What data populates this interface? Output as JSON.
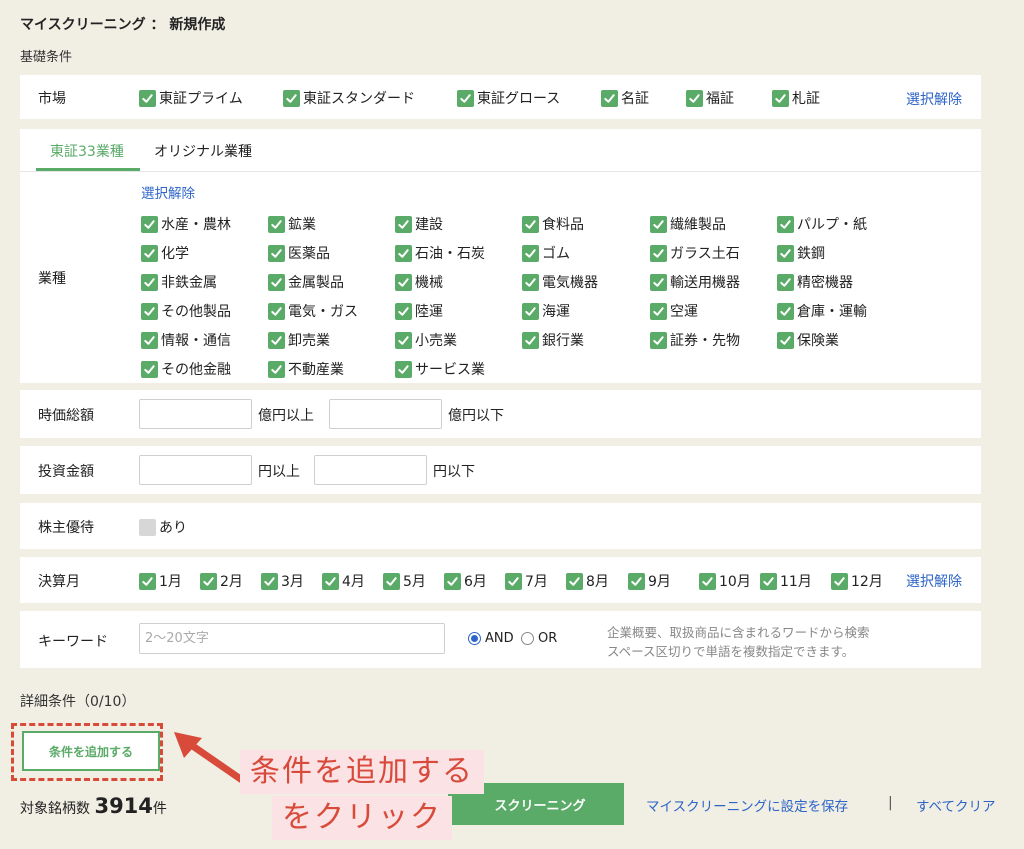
{
  "page": {
    "title": "マイスクリーニング ： 新規作成",
    "basic_label": "基礎条件",
    "detail_label": "詳細条件（0/10）"
  },
  "market": {
    "label": "市場",
    "items": [
      "東証プライム",
      "東証スタンダード",
      "東証グロース",
      "名証",
      "福証",
      "札証"
    ],
    "clear": "選択解除"
  },
  "industry": {
    "tabs": [
      "東証33業種",
      "オリジナル業種"
    ],
    "active_tab": "東証33業種",
    "label": "業種",
    "clear": "選択解除",
    "items": [
      "水産・農林",
      "鉱業",
      "建設",
      "食料品",
      "繊維製品",
      "パルプ・紙",
      "化学",
      "医薬品",
      "石油・石炭",
      "ゴム",
      "ガラス土石",
      "鉄鋼",
      "非鉄金属",
      "金属製品",
      "機械",
      "電気機器",
      "輸送用機器",
      "精密機器",
      "その他製品",
      "電気・ガス",
      "陸運",
      "海運",
      "空運",
      "倉庫・運輸",
      "情報・通信",
      "卸売業",
      "小売業",
      "銀行業",
      "証券・先物",
      "保険業",
      "その他金融",
      "不動産業",
      "サービス業"
    ]
  },
  "market_cap": {
    "label": "時価総額",
    "min_unit": "億円以上",
    "max_unit": "億円以下",
    "min_value": "",
    "max_value": ""
  },
  "investment": {
    "label": "投資金額",
    "min_unit": "円以上",
    "max_unit": "円以下",
    "min_value": "",
    "max_value": ""
  },
  "yutai": {
    "label": "株主優待",
    "option": "あり",
    "checked": false
  },
  "settlement": {
    "label": "決算月",
    "months": [
      "1月",
      "2月",
      "3月",
      "4月",
      "5月",
      "6月",
      "7月",
      "8月",
      "9月",
      "10月",
      "11月",
      "12月"
    ],
    "clear": "選択解除"
  },
  "keyword": {
    "label": "キーワード",
    "placeholder": "2〜20文字",
    "and_label": "AND",
    "or_label": "OR",
    "selected": "AND",
    "hint1": "企業概要、取扱商品に含まれるワードから検索",
    "hint2": "スペース区切りで単語を複数指定できます。"
  },
  "footer": {
    "add_button": "条件を追加する",
    "count_label": "対象銘柄数",
    "count_value": "3914",
    "count_unit": "件",
    "screen_button": "スクリーニング",
    "save_link": "マイスクリーニングに設定を保存",
    "separator": "|",
    "clear_all": "すべてクリア"
  },
  "annotation": {
    "line1": "条件を追加する",
    "line2": "をクリック"
  },
  "colors": {
    "accent_green": "#5aaa68",
    "link_blue": "#2d64c8",
    "annotation_red": "#d84a3a",
    "annotation_bg": "#fbe2e4",
    "page_bg": "#f1efe4"
  }
}
